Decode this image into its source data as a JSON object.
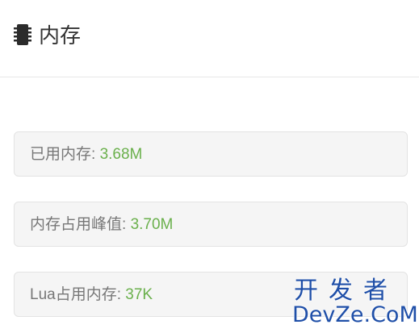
{
  "header": {
    "icon": "memory-chip-icon",
    "title": "内存"
  },
  "stats": [
    {
      "label": "已用内存: ",
      "value": "3.68M"
    },
    {
      "label": "内存占用峰值: ",
      "value": "3.70M"
    },
    {
      "label": "Lua占用内存: ",
      "value": "37K"
    }
  ],
  "watermark": {
    "line1": "开发者",
    "line2": "DevZe.CoM"
  },
  "colors": {
    "value": "#6ab04c",
    "label": "#777777",
    "card_bg": "#f5f5f5",
    "watermark": "#1f4fa8"
  }
}
